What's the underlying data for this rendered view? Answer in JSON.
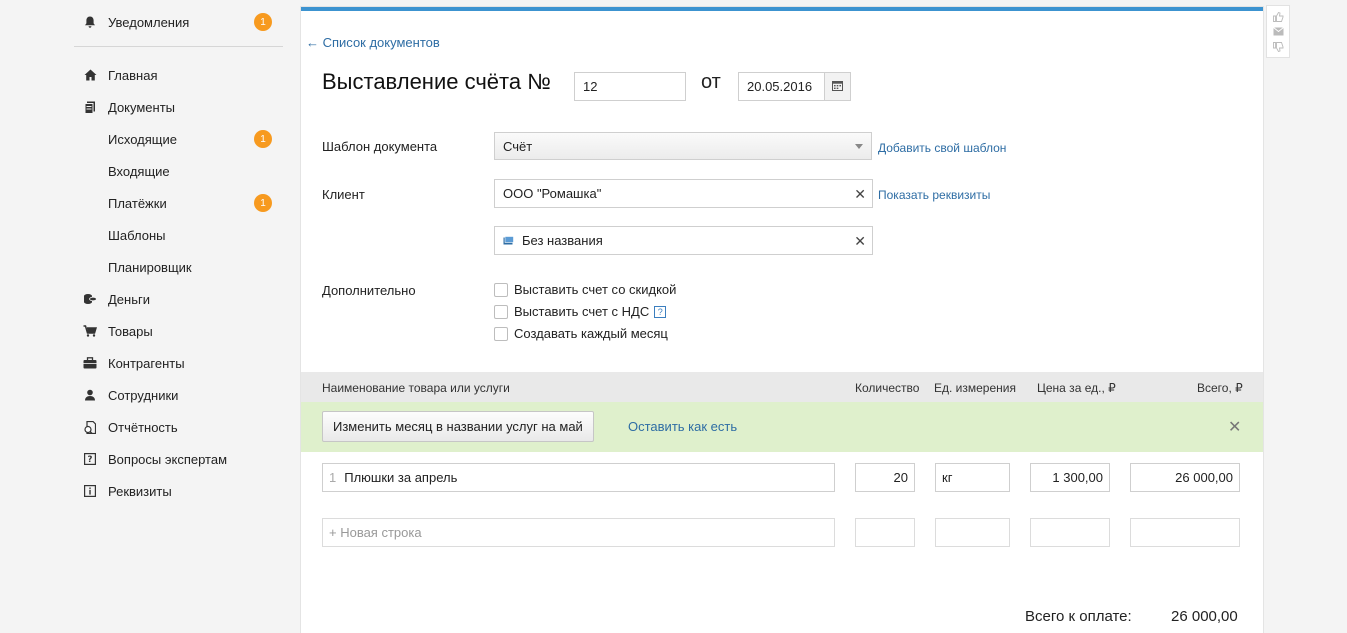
{
  "sidebar": {
    "notifications": {
      "label": "Уведомления",
      "badge": "1",
      "icon": "bell-icon"
    },
    "items": [
      {
        "label": "Главная",
        "icon": "home-icon"
      },
      {
        "label": "Документы",
        "icon": "documents-icon"
      },
      {
        "label": "Исходящие",
        "badge": "1"
      },
      {
        "label": "Входящие"
      },
      {
        "label": "Платёжки",
        "badge": "1"
      },
      {
        "label": "Шаблоны"
      },
      {
        "label": "Планировщик"
      },
      {
        "label": "Деньги",
        "icon": "money-icon"
      },
      {
        "label": "Товары",
        "icon": "cart-icon"
      },
      {
        "label": "Контрагенты",
        "icon": "briefcase-icon"
      },
      {
        "label": "Сотрудники",
        "icon": "person-icon"
      },
      {
        "label": "Отчётность",
        "icon": "report-icon"
      },
      {
        "label": "Вопросы экспертам",
        "icon": "question-icon"
      },
      {
        "label": "Реквизиты",
        "icon": "info-icon"
      }
    ]
  },
  "header": {
    "back_link": "← Список документов",
    "title": "Выставление счёта №",
    "number": "12",
    "date_sep": "от",
    "date": "20.05.2016"
  },
  "form": {
    "template_label": "Шаблон документа",
    "template_value": "Счёт",
    "template_link": "Добавить свой шаблон",
    "client_label": "Клиент",
    "client_value": "ООО \"Ромашка\"",
    "client_link": "Показать реквизиты",
    "account_value": "Без названия",
    "extra_label": "Дополнительно",
    "checkboxes": [
      {
        "label": "Выставить счет со скидкой",
        "checked": false
      },
      {
        "label": "Выставить счет с НДС",
        "checked": false
      },
      {
        "label": "Создавать каждый месяц",
        "checked": false
      }
    ]
  },
  "table": {
    "headers": {
      "name": "Наименование товара или услуги",
      "qty": "Количество",
      "unit": "Ед. измерения",
      "price": "Цена за ед., ₽",
      "total": "Всего, ₽"
    },
    "hint": {
      "button": "Изменить месяц в названии услуг на май",
      "link": "Оставить как есть"
    },
    "rows": [
      {
        "num": "1",
        "name": "Плюшки за апрель",
        "qty": "20",
        "unit": "кг",
        "price": "1 300,00",
        "total": "26 000,00"
      }
    ],
    "new_row_placeholder": "+ Новая строка"
  },
  "totals": {
    "label": "Всего к оплате:",
    "value": "26 000,00"
  },
  "colors": {
    "accent": "#3c93d0",
    "badge": "#f79a1f",
    "hint_bg": "#dff0cc",
    "link": "#2e6da4"
  }
}
